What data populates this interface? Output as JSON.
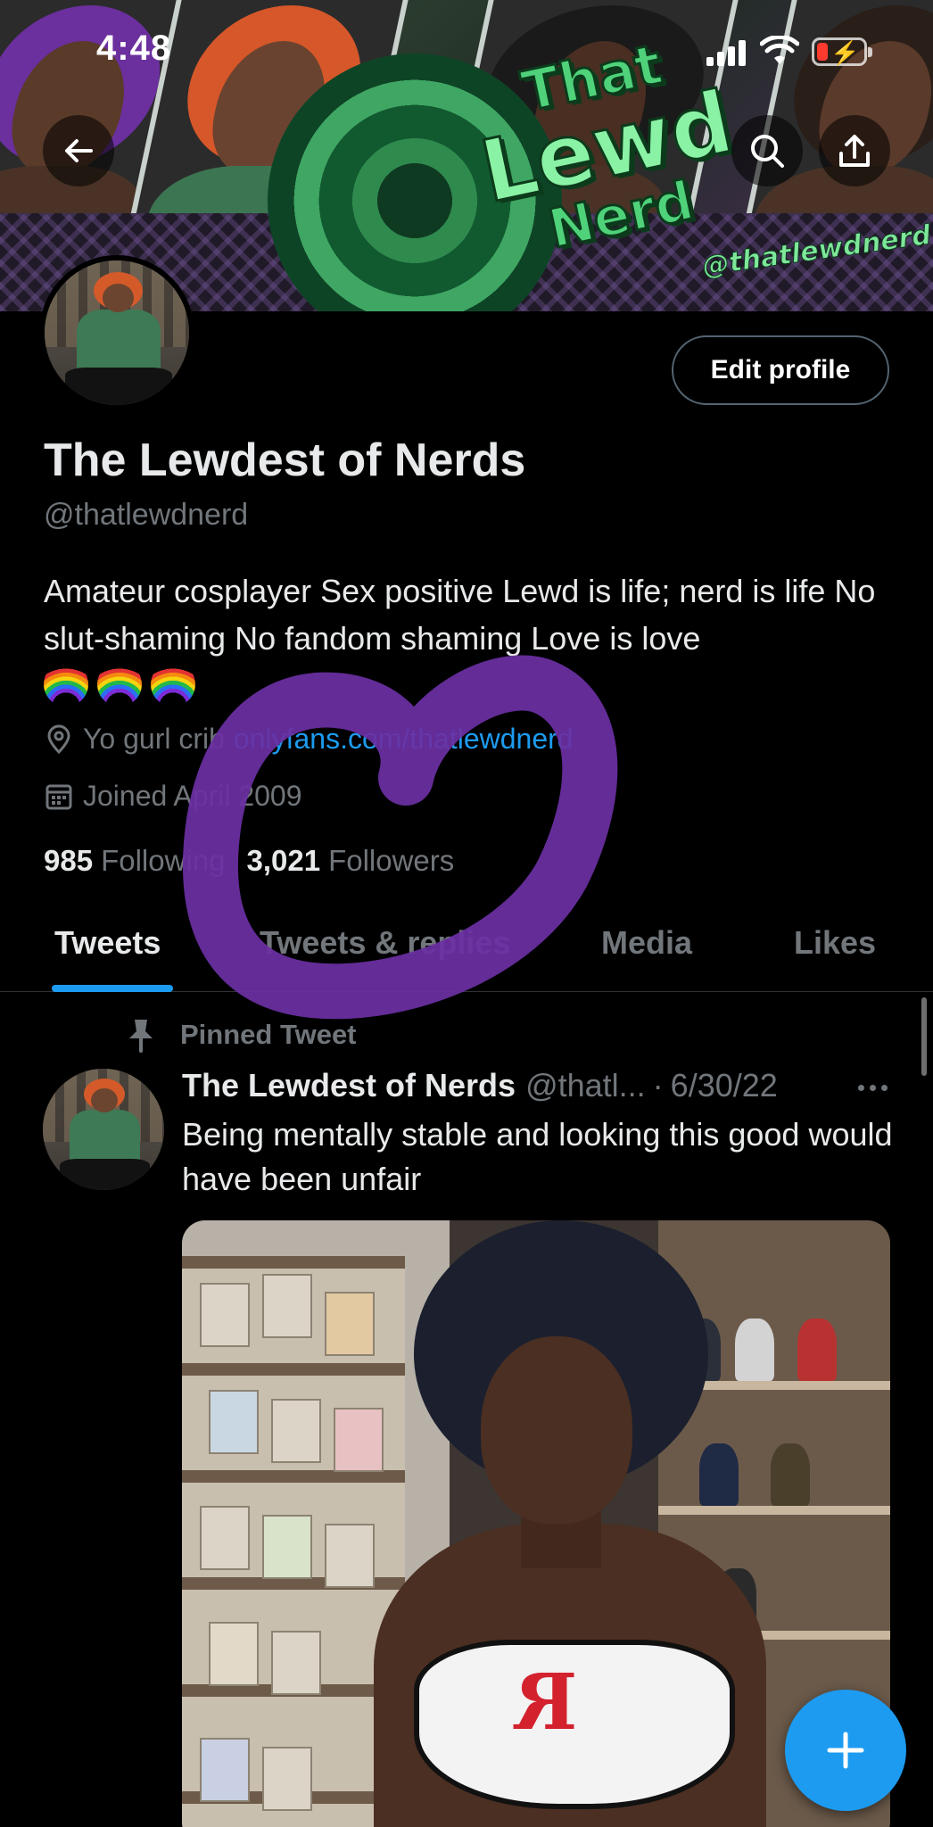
{
  "status_bar": {
    "time": "4:48"
  },
  "banner": {
    "logo_line1": "That",
    "logo_line2": "Lewd",
    "logo_line3": "Nerd",
    "handle_text": "@thatlewdnerd"
  },
  "profile": {
    "edit_label": "Edit profile",
    "display_name": "The Lewdest of Nerds",
    "handle": "@thatlewdnerd",
    "bio": "Amateur cosplayer Sex positive Lewd is life; nerd is life No slut-shaming No fandom shaming Love is love",
    "location": "Yo gurl crib",
    "link": "onlyfans.com/thatlewdnerd",
    "joined": "Joined April 2009",
    "following_count": "985",
    "following_label": "Following",
    "followers_count": "3,021",
    "followers_label": "Followers"
  },
  "tabs": [
    {
      "label": "Tweets",
      "active": true
    },
    {
      "label": "Tweets & replies",
      "active": false
    },
    {
      "label": "Media",
      "active": false
    },
    {
      "label": "Likes",
      "active": false
    }
  ],
  "pinned_tweet": {
    "pinned_label": "Pinned Tweet",
    "author": "The Lewdest of Nerds",
    "handle": "@thatl...",
    "separator": "·",
    "date": "6/30/22",
    "text": "Being mentally stable and looking this good would have been unfair"
  },
  "icons": {
    "back": "arrow-left-icon",
    "search": "search-icon",
    "share": "share-icon",
    "location": "location-pin-icon",
    "calendar": "calendar-icon",
    "pin": "pin-icon",
    "more": "more-dots-icon",
    "compose": "plus-icon"
  },
  "colors": {
    "accent": "#1d9bf0",
    "background": "#000000",
    "muted": "#71767b",
    "annotation": "#6a2fa3"
  }
}
